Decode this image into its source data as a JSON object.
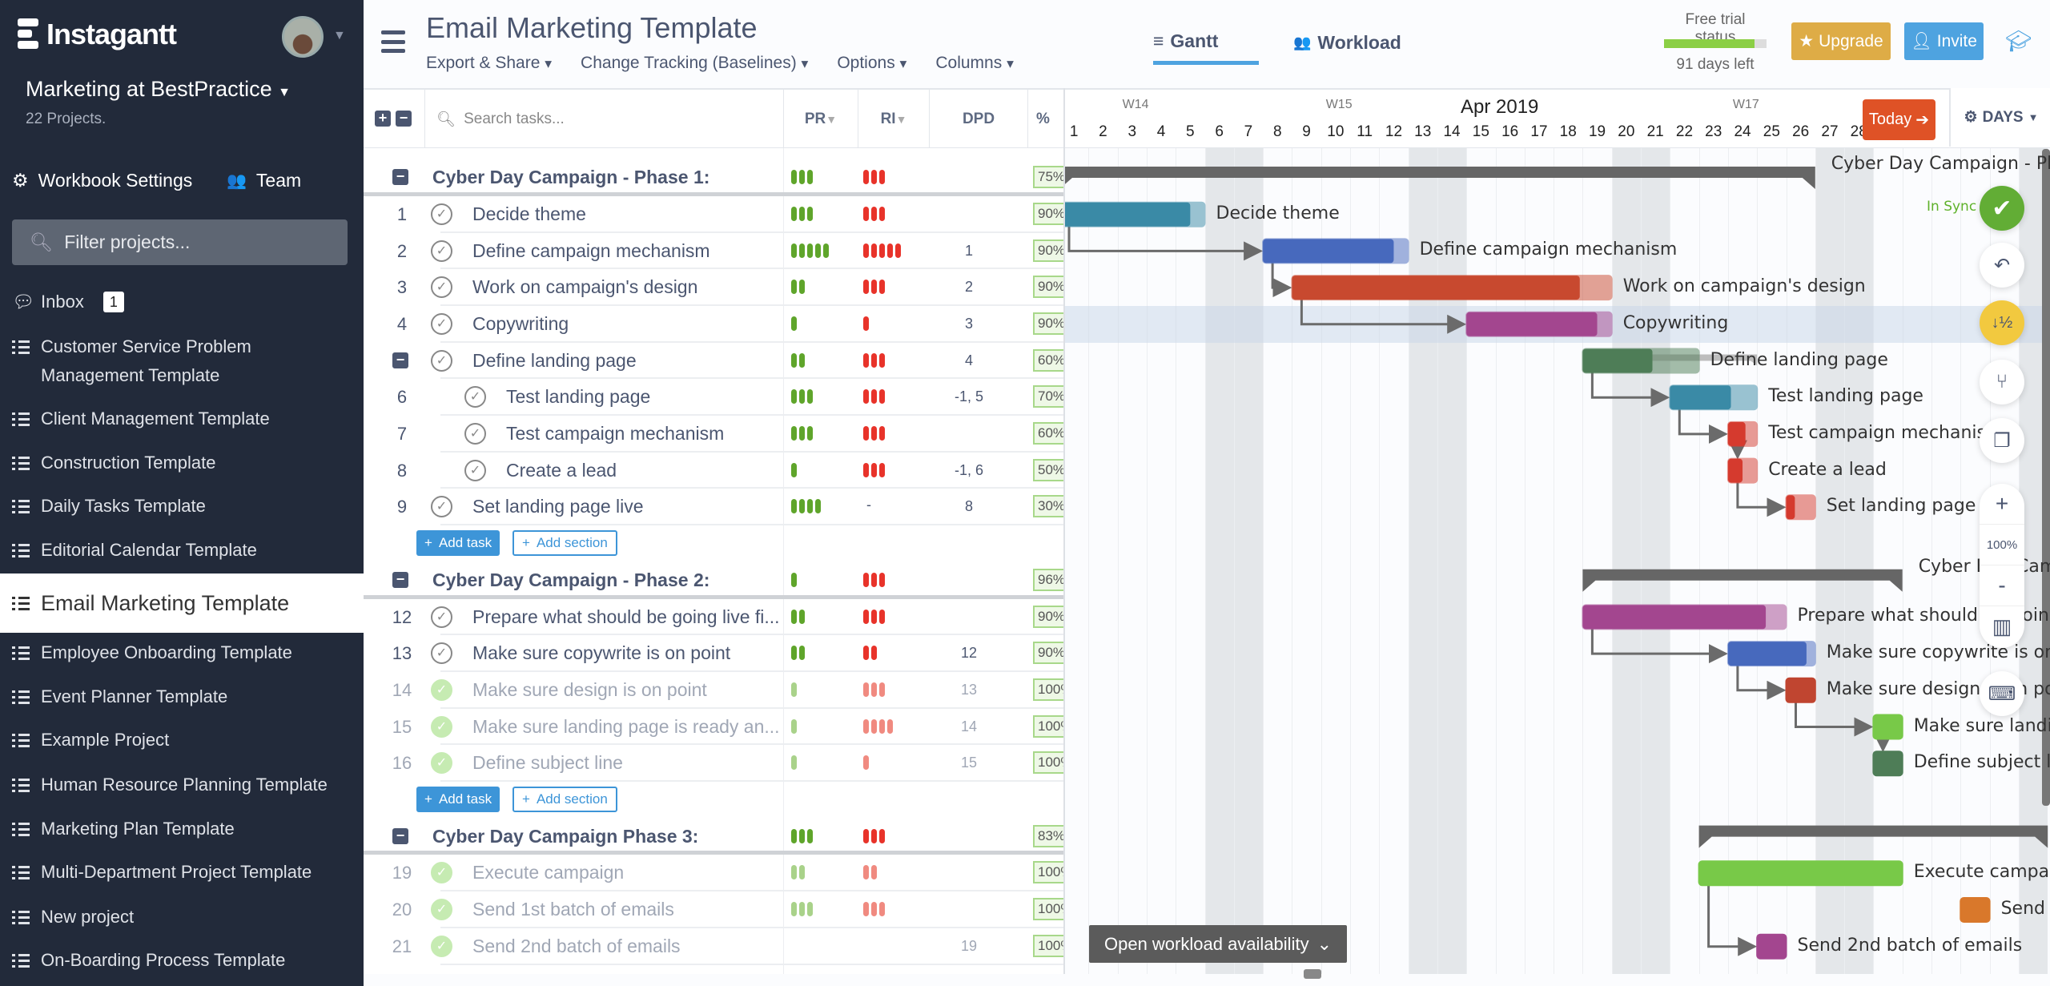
{
  "sidebar": {
    "brand": "Instagantt",
    "workspace": "Marketing at BestPractice",
    "project_count": "22 Projects.",
    "workbook_settings": "Workbook Settings",
    "team": "Team",
    "filter_placeholder": "Filter projects...",
    "inbox": {
      "label": "Inbox",
      "badge": "1"
    },
    "projects": [
      {
        "label": "Customer Service Problem Management Template"
      },
      {
        "label": "Client Management Template"
      },
      {
        "label": "Construction Template"
      },
      {
        "label": "Daily Tasks Template"
      },
      {
        "label": "Editorial Calendar Template"
      },
      {
        "label": "Email Marketing Template",
        "active": true
      },
      {
        "label": "Employee Onboarding Template"
      },
      {
        "label": "Event Planner Template"
      },
      {
        "label": "Example Project"
      },
      {
        "label": "Human Resource Planning Template"
      },
      {
        "label": "Marketing Plan Template"
      },
      {
        "label": "Multi-Department Project Template"
      },
      {
        "label": "New project"
      },
      {
        "label": "On-Boarding Process Template"
      }
    ]
  },
  "header": {
    "title": "Email Marketing Template",
    "menus": [
      "Export & Share",
      "Change Tracking (Baselines)",
      "Options",
      "Columns"
    ],
    "tabs": [
      {
        "label": "Gantt",
        "active": true
      },
      {
        "label": "Workload"
      }
    ],
    "trial": {
      "label": "Free trial status",
      "days_left": "91 days left",
      "progress": 0.88
    },
    "upgrade": "Upgrade",
    "invite": "Invite"
  },
  "list": {
    "search_placeholder": "Search tasks...",
    "columns": [
      "PR",
      "RI",
      "DPD",
      "%"
    ],
    "add_task": "Add task",
    "add_section": "Add section",
    "rows": [
      {
        "type": "section",
        "name": "Cyber Day Campaign - Phase 1:",
        "pr": 3,
        "ri": 3,
        "pct": "75%"
      },
      {
        "type": "task",
        "num": "1",
        "name": "Decide theme",
        "pr": 3,
        "ri": 3,
        "dpd": "",
        "pct": "90%"
      },
      {
        "type": "task",
        "num": "2",
        "name": "Define campaign mechanism",
        "pr": 5,
        "ri": 5,
        "dpd": "1",
        "pct": "90%"
      },
      {
        "type": "task",
        "num": "3",
        "name": "Work on campaign's design",
        "pr": 2,
        "ri": 3,
        "dpd": "2",
        "pct": "90%"
      },
      {
        "type": "task",
        "num": "4",
        "name": "Copywriting",
        "pr": 1,
        "ri": 1,
        "dpd": "3",
        "pct": "90%",
        "highlight": true
      },
      {
        "type": "task",
        "num": "",
        "collapsible": true,
        "name": "Define landing page",
        "pr": 2,
        "ri": 3,
        "dpd": "4",
        "pct": "60%"
      },
      {
        "type": "task",
        "num": "6",
        "indent": true,
        "name": "Test landing page",
        "pr": 3,
        "ri": 3,
        "dpd": "-1, 5",
        "pct": "70%"
      },
      {
        "type": "task",
        "num": "7",
        "indent": true,
        "name": "Test campaign mechanism",
        "pr": 3,
        "ri": 3,
        "dpd": "",
        "pct": "60%"
      },
      {
        "type": "task",
        "num": "8",
        "indent": true,
        "name": "Create a lead",
        "pr": 1,
        "ri": 3,
        "dpd": "-1, 6",
        "pct": "50%"
      },
      {
        "type": "task",
        "num": "9",
        "name": "Set landing page live",
        "pr": 4,
        "ri": 0,
        "ri_text": "-",
        "dpd": "8",
        "pct": "30%"
      },
      {
        "type": "add"
      },
      {
        "type": "section",
        "name": "Cyber Day Campaign - Phase 2:",
        "pr": 1,
        "ri": 3,
        "pct": "96%"
      },
      {
        "type": "task",
        "num": "12",
        "name": "Prepare what should be going live fi...",
        "pr": 2,
        "ri": 3,
        "dpd": "",
        "pct": "90%"
      },
      {
        "type": "task",
        "num": "13",
        "name": "Make sure copywrite is on point",
        "pr": 2,
        "ri": 2,
        "dpd": "12",
        "pct": "90%"
      },
      {
        "type": "task",
        "num": "14",
        "done": true,
        "name": "Make sure design is on point",
        "pr": 1,
        "ri": 3,
        "dpd": "13",
        "pct": "100%"
      },
      {
        "type": "task",
        "num": "15",
        "done": true,
        "name": "Make sure landing page is ready an...",
        "pr": 1,
        "ri": 4,
        "dpd": "14",
        "pct": "100%"
      },
      {
        "type": "task",
        "num": "16",
        "done": true,
        "name": "Define subject line",
        "pr": 1,
        "ri": 1,
        "dpd": "15",
        "pct": "100%"
      },
      {
        "type": "add"
      },
      {
        "type": "section",
        "name": "Cyber Day Campaign Phase 3:",
        "pr": 3,
        "ri": 3,
        "pct": "83%"
      },
      {
        "type": "task",
        "num": "19",
        "done": true,
        "name": "Execute campaign",
        "pr": 2,
        "ri": 2,
        "dpd": "",
        "pct": "100%"
      },
      {
        "type": "task",
        "num": "20",
        "done": true,
        "name": "Send 1st batch of emails",
        "pr": 3,
        "ri": 3,
        "dpd": "",
        "pct": "100%"
      },
      {
        "type": "task",
        "num": "21",
        "done": true,
        "name": "Send 2nd batch of emails",
        "pr": 0,
        "ri": 0,
        "dpd": "19",
        "pct": "100%"
      }
    ]
  },
  "gantt": {
    "month": "Apr 2019",
    "weeks": [
      {
        "label": "W14",
        "day": 3
      },
      {
        "label": "W15",
        "day": 10
      },
      {
        "label": "W17",
        "day": 24
      }
    ],
    "days": [
      1,
      2,
      3,
      4,
      5,
      6,
      7,
      8,
      9,
      10,
      11,
      12,
      13,
      14,
      15,
      16,
      17,
      18,
      19,
      20,
      21,
      22,
      23,
      24,
      25,
      26,
      27,
      28
    ],
    "weekend_days": [
      6,
      7,
      13,
      14,
      20,
      21,
      27,
      28,
      34
    ],
    "today": "Today",
    "scale": "DAYS",
    "sync_status": "In Sync",
    "zoom": "100%",
    "workload_button": "Open workload availability",
    "bars": [
      {
        "row": 0,
        "summary": true,
        "start": 1,
        "end": 26,
        "label": "Cyber Day Campaign - Phase 1:"
      },
      {
        "row": 1,
        "start": 1,
        "end": 5,
        "color": "#3a8aa6",
        "progress": 0.9,
        "label": "Decide theme"
      },
      {
        "row": 2,
        "start": 8,
        "end": 12,
        "color": "#4769bd",
        "progress": 0.9,
        "label": "Define campaign mechanism"
      },
      {
        "row": 3,
        "start": 9,
        "end": 19,
        "color": "#c8492f",
        "progress": 0.9,
        "label": "Work on campaign's design"
      },
      {
        "row": 4,
        "start": 15,
        "end": 19,
        "color": "#a3468f",
        "progress": 0.9,
        "label": "Copywriting"
      },
      {
        "row": 5,
        "start": 19,
        "end": 22,
        "color": "#4e7d57",
        "progress": 0.6,
        "subsummary_end": 24,
        "label": "Define landing page"
      },
      {
        "row": 6,
        "start": 22,
        "end": 24,
        "color": "#3a8aa6",
        "progress": 0.7,
        "label": "Test landing page"
      },
      {
        "row": 7,
        "start": 24,
        "end": 24,
        "color": "#d53a2e",
        "progress": 0.6,
        "label": "Test campaign mechanism"
      },
      {
        "row": 8,
        "start": 24,
        "end": 24,
        "color": "#d53a2e",
        "progress": 0.5,
        "label": "Create a lead"
      },
      {
        "row": 9,
        "start": 26,
        "end": 26,
        "color": "#d53a2e",
        "progress": 0.3,
        "label": "Set landing page live"
      },
      {
        "row": 11,
        "summary": true,
        "start": 19,
        "end": 29,
        "label": "Cyber Day Campaign - Phase 2:"
      },
      {
        "row": 12,
        "start": 19,
        "end": 25,
        "color": "#a3468f",
        "progress": 0.9,
        "label": "Prepare what should be going live first"
      },
      {
        "row": 13,
        "start": 24,
        "end": 26,
        "color": "#4769bd",
        "progress": 0.9,
        "label": "Make sure copywrite is on point"
      },
      {
        "row": 14,
        "start": 26,
        "end": 26,
        "color": "#c04530",
        "progress": 1,
        "label": "Make sure design is on point"
      },
      {
        "row": 15,
        "start": 29,
        "end": 29,
        "color": "#78c948",
        "progress": 1,
        "label": "Make sure landing page is ready and"
      },
      {
        "row": 16,
        "start": 29,
        "end": 29,
        "color": "#4e7d57",
        "progress": 1,
        "label": "Define subject line"
      },
      {
        "row": 18,
        "summary": true,
        "start": 23,
        "end": 34,
        "label": "Cyber Day Campaign Phase 3:"
      },
      {
        "row": 19,
        "start": 23,
        "end": 29,
        "color": "#78c948",
        "progress": 1,
        "label": "Execute campaign"
      },
      {
        "row": 20,
        "start": 32,
        "end": 32,
        "color": "#d9782b",
        "progress": 1,
        "label": "Send 1st batch of emails"
      },
      {
        "row": 21,
        "start": 25,
        "end": 25,
        "color": "#a3468f",
        "progress": 1,
        "label": "Send 2nd batch of emails"
      }
    ],
    "links": [
      [
        1,
        2
      ],
      [
        2,
        3
      ],
      [
        3,
        4
      ],
      [
        5,
        6
      ],
      [
        6,
        7
      ],
      [
        7,
        8
      ],
      [
        8,
        9
      ],
      [
        12,
        13
      ],
      [
        13,
        14
      ],
      [
        14,
        15
      ],
      [
        15,
        16
      ],
      [
        19,
        21
      ]
    ]
  }
}
